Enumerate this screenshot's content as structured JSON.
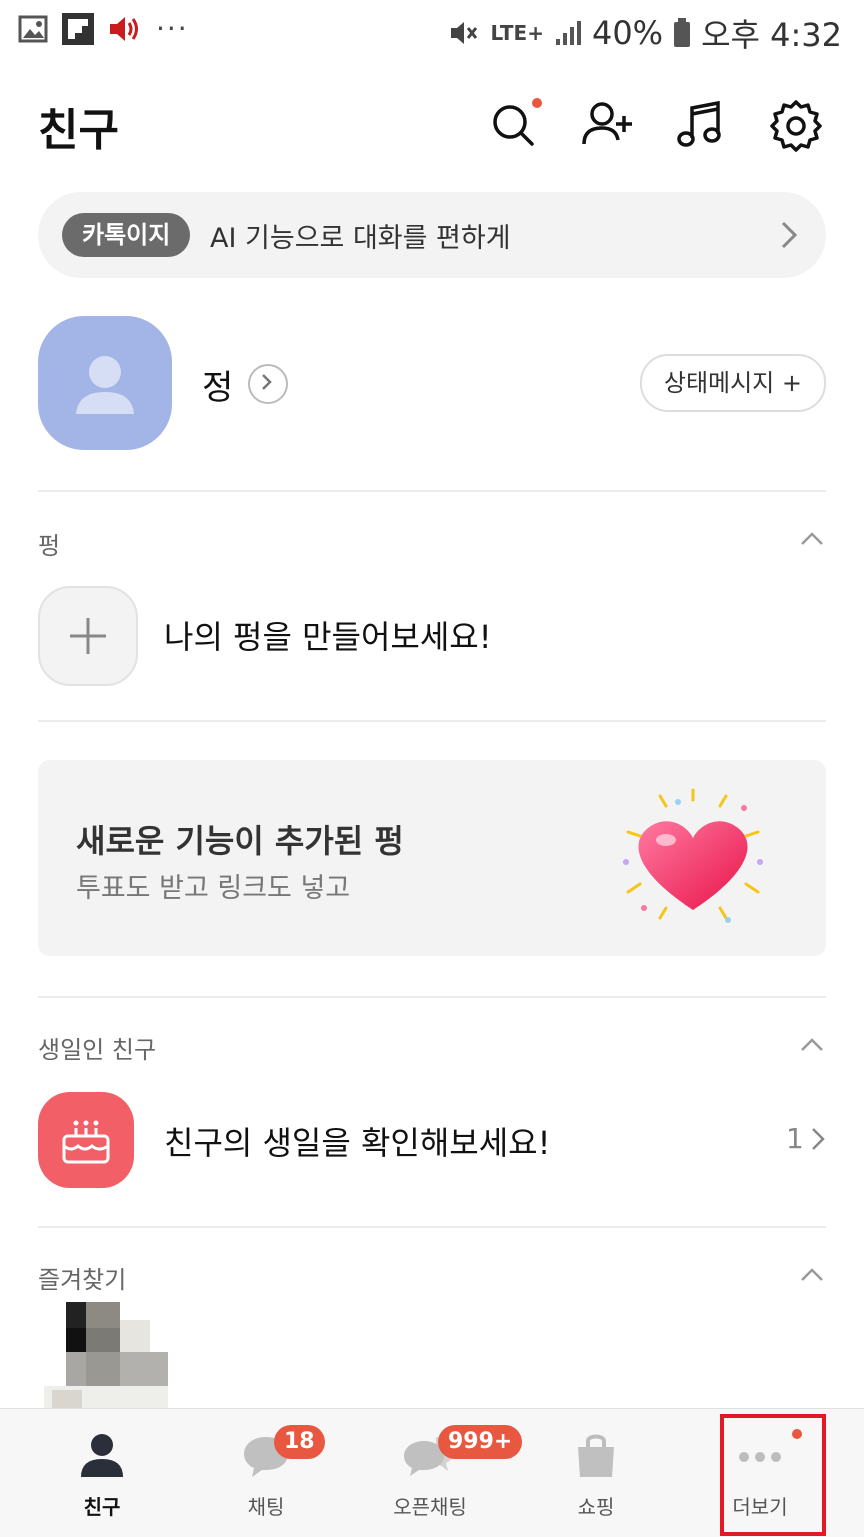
{
  "statusbar": {
    "battery": "40%",
    "time": "오후 4:32",
    "network": "LTE+"
  },
  "header": {
    "title": "친구"
  },
  "banner": {
    "chip": "카톡이지",
    "text": "AI 기능으로 대화를 편하게"
  },
  "profile": {
    "name": "정",
    "status_button": "상태메시지 +"
  },
  "pung": {
    "section_label": "펑",
    "create_text": "나의 펑을 만들어보세요!",
    "promo_title": "새로운 기능이 추가된 펑",
    "promo_subtitle": "투표도 받고 링크도 넣고"
  },
  "birthday": {
    "section_label": "생일인 친구",
    "text": "친구의 생일을 확인해보세요!",
    "count": "1"
  },
  "favorites": {
    "section_label": "즐겨찾기"
  },
  "nav": {
    "items": [
      {
        "label": "친구"
      },
      {
        "label": "채팅",
        "badge": "18"
      },
      {
        "label": "오픈채팅",
        "badge": "999+"
      },
      {
        "label": "쇼핑"
      },
      {
        "label": "더보기"
      }
    ]
  },
  "colors": {
    "accent_dot": "#e8573f",
    "avatar_bg": "#a3b4e6",
    "birthday_bg": "#f25f66",
    "highlight_box": "#e01b24"
  }
}
